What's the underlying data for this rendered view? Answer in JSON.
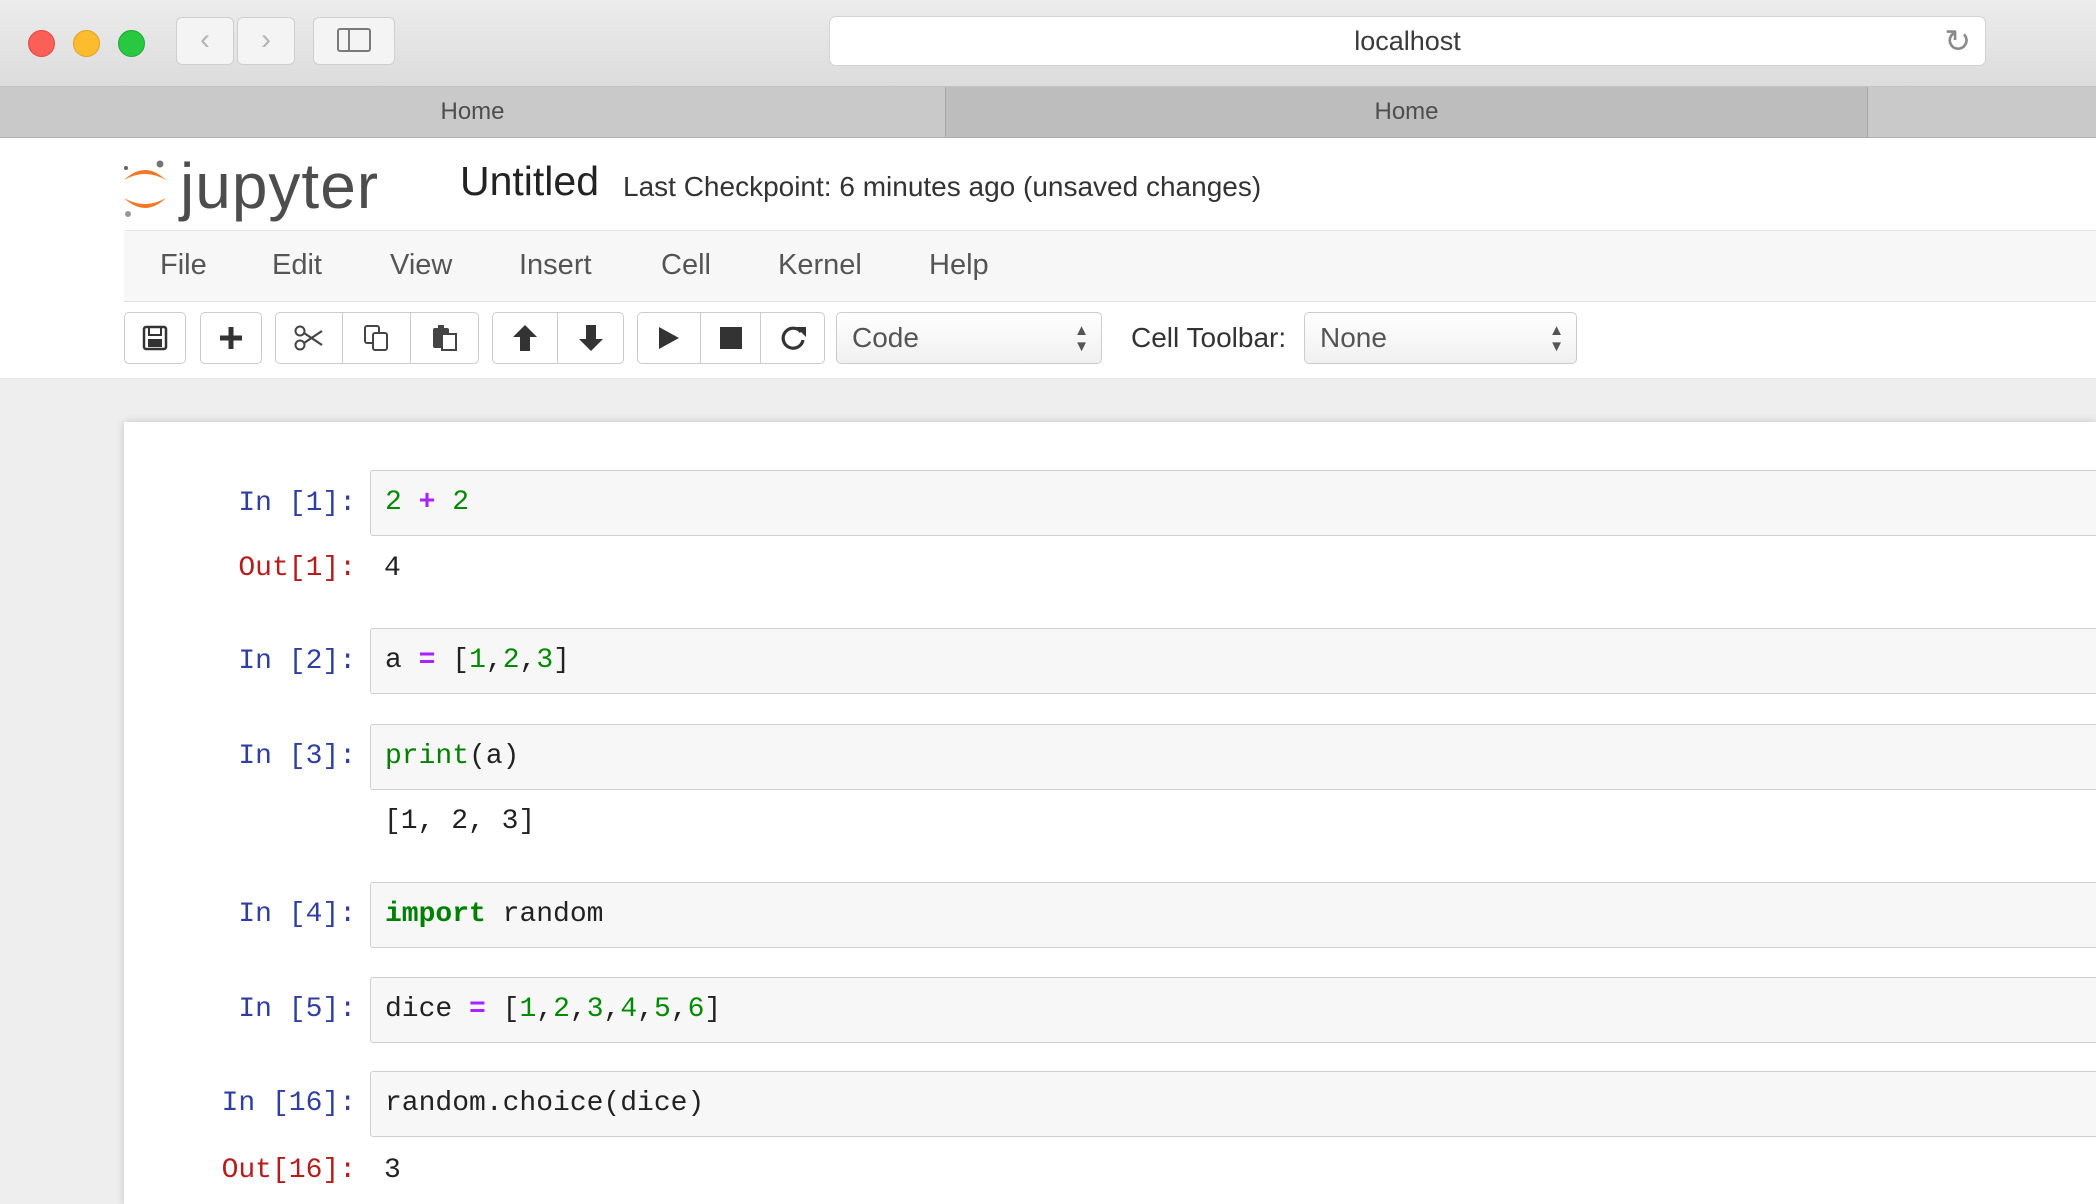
{
  "browser": {
    "url": "localhost",
    "tabs": [
      "Home",
      "Home"
    ],
    "traffic_light_colors": [
      "#fc5f57",
      "#fdbc2e",
      "#28c840"
    ]
  },
  "notebook_header": {
    "logo_text": "jupyter",
    "name": "Untitled",
    "checkpoint": "Last Checkpoint: 6 minutes ago (unsaved changes)"
  },
  "menu": [
    "File",
    "Edit",
    "View",
    "Insert",
    "Cell",
    "Kernel",
    "Help"
  ],
  "toolbar": {
    "cell_type": "Code",
    "cell_toolbar_label": "Cell Toolbar:",
    "cell_toolbar_value": "None",
    "buttons": [
      "save-icon",
      "plus-icon",
      "cut-icon",
      "copy-icon",
      "paste-icon",
      "arrow-up-icon",
      "arrow-down-icon",
      "run-icon",
      "stop-icon",
      "restart-icon"
    ]
  },
  "cells": [
    {
      "in_prompt": "In [1]:",
      "tokens": [
        [
          "num",
          "2"
        ],
        [
          "sp",
          " "
        ],
        [
          "op",
          "+"
        ],
        [
          "sp",
          " "
        ],
        [
          "num",
          "2"
        ]
      ],
      "out_prompt": "Out[1]:",
      "output": "4"
    },
    {
      "in_prompt": "In [2]:",
      "tokens": [
        [
          "var",
          "a"
        ],
        [
          "sp",
          " "
        ],
        [
          "op",
          "="
        ],
        [
          "sp",
          " "
        ],
        [
          "var",
          "["
        ],
        [
          "num",
          "1"
        ],
        [
          "var",
          ","
        ],
        [
          "num",
          "2"
        ],
        [
          "var",
          ","
        ],
        [
          "num",
          "3"
        ],
        [
          "var",
          "]"
        ]
      ]
    },
    {
      "in_prompt": "In [3]:",
      "tokens": [
        [
          "bi",
          "print"
        ],
        [
          "var",
          "(a)"
        ]
      ],
      "stdout": "[1, 2, 3]"
    },
    {
      "in_prompt": "In [4]:",
      "tokens": [
        [
          "kw",
          "import"
        ],
        [
          "sp",
          " "
        ],
        [
          "var",
          "random"
        ]
      ]
    },
    {
      "in_prompt": "In [5]:",
      "tokens": [
        [
          "var",
          "dice"
        ],
        [
          "sp",
          " "
        ],
        [
          "op",
          "="
        ],
        [
          "sp",
          " "
        ],
        [
          "var",
          "["
        ],
        [
          "num",
          "1"
        ],
        [
          "var",
          ","
        ],
        [
          "num",
          "2"
        ],
        [
          "var",
          ","
        ],
        [
          "num",
          "3"
        ],
        [
          "var",
          ","
        ],
        [
          "num",
          "4"
        ],
        [
          "var",
          ","
        ],
        [
          "num",
          "5"
        ],
        [
          "var",
          ","
        ],
        [
          "num",
          "6"
        ],
        [
          "var",
          "]"
        ]
      ]
    },
    {
      "in_prompt": "In [16]:",
      "tokens": [
        [
          "var",
          "random.choice(dice)"
        ]
      ],
      "out_prompt": "Out[16]:",
      "output": "3"
    }
  ]
}
